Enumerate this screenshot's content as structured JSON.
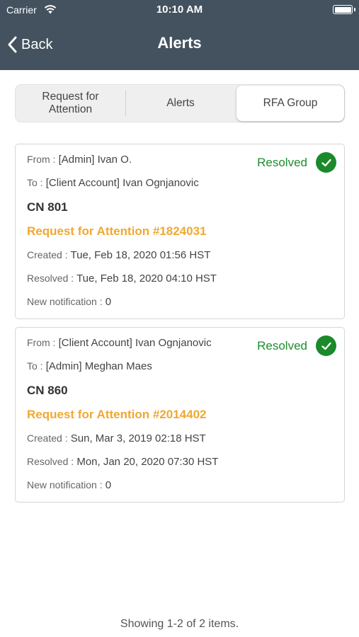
{
  "status_bar": {
    "carrier": "Carrier",
    "time": "10:10 AM"
  },
  "nav": {
    "back_label": "Back",
    "title": "Alerts"
  },
  "segments": [
    {
      "label": "Request for Attention",
      "selected": false
    },
    {
      "label": "Alerts",
      "selected": false
    },
    {
      "label": "RFA Group",
      "selected": true
    }
  ],
  "cards": [
    {
      "from_label": "From :",
      "from": "[Admin] Ivan O.",
      "to_label": "To :",
      "to": "[Client Account] Ivan Ognjanovic",
      "cn": "CN 801",
      "rfa": "Request for Attention #1824031",
      "created_label": "Created :",
      "created": "Tue, Feb 18, 2020 01:56 HST",
      "resolved_label": "Resolved :",
      "resolved": "Tue, Feb 18, 2020 04:10 HST",
      "notif_label": "New notification :",
      "notif": "0",
      "status": "Resolved"
    },
    {
      "from_label": "From :",
      "from": "[Client Account] Ivan Ognjanovic",
      "to_label": "To :",
      "to": "[Admin] Meghan Maes",
      "cn": "CN 860",
      "rfa": "Request for Attention #2014402",
      "created_label": "Created :",
      "created": "Sun, Mar 3, 2019 02:18 HST",
      "resolved_label": "Resolved :",
      "resolved": "Mon, Jan 20, 2020 07:30 HST",
      "notif_label": "New notification :",
      "notif": "0",
      "status": "Resolved"
    }
  ],
  "footer": "Showing 1-2 of 2 items.",
  "colors": {
    "header": "#44525f",
    "accent_orange": "#f0a830",
    "resolved_green": "#1a8a2a"
  },
  "icons": {
    "back": "chevron-left-icon",
    "status": "check-circle-icon",
    "wifi": "wifi-icon",
    "battery": "battery-icon"
  }
}
